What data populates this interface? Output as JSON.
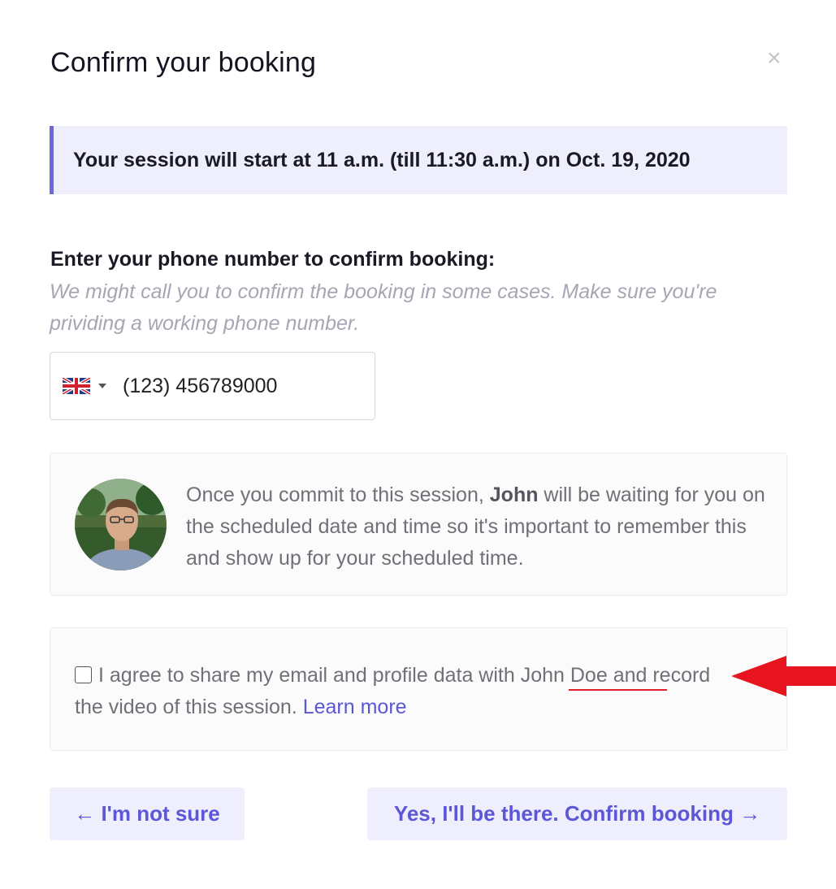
{
  "modal": {
    "title": "Confirm your booking",
    "close_label": "×"
  },
  "banner": {
    "text": "Your session will start at 11 a.m. (till 11:30 a.m.) on Oct. 19, 2020"
  },
  "phone": {
    "label": "Enter your phone number to confirm booking:",
    "hint": "We might call you to confirm the booking in some cases. Make sure you're prividing a working phone number.",
    "country_flag": "uk-flag-icon",
    "value": "(123) 456789000"
  },
  "info": {
    "text_before": "Once you commit to this session, ",
    "host_name": "John",
    "text_after": " will be waiting for you on the scheduled date and time so it's important to remember this and show up for your scheduled time."
  },
  "agreement": {
    "checked": false,
    "text_before": "I agree to share my email and profile data with ",
    "host_full_name": "John Doe",
    "text_after": " and record the video of this session. ",
    "learn_more": "Learn more"
  },
  "buttons": {
    "back_label": "← I'm not sure",
    "confirm_label": "Yes, I'll be there. Confirm booking →"
  },
  "colors": {
    "accent": "#5b57d6",
    "banner_bg": "#efeefc",
    "banner_border": "#6b67e0",
    "annotation": "#e0202a"
  }
}
